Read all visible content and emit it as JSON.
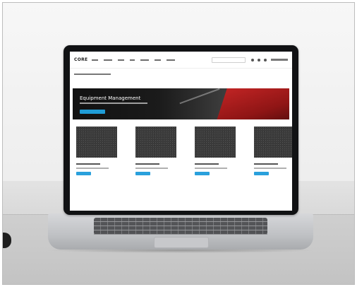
{
  "site": {
    "logo": "CORE",
    "hero_title": "Equipment Management"
  },
  "products": [
    {
      "id": 1
    },
    {
      "id": 2
    },
    {
      "id": 3
    },
    {
      "id": 4
    }
  ],
  "colors": {
    "accent": "#1f9cd6",
    "hero_red": "#c72626",
    "laptop_bezel": "#111214"
  },
  "icons": [
    "search-icon",
    "user-icon",
    "cart-icon",
    "menu-icon"
  ]
}
